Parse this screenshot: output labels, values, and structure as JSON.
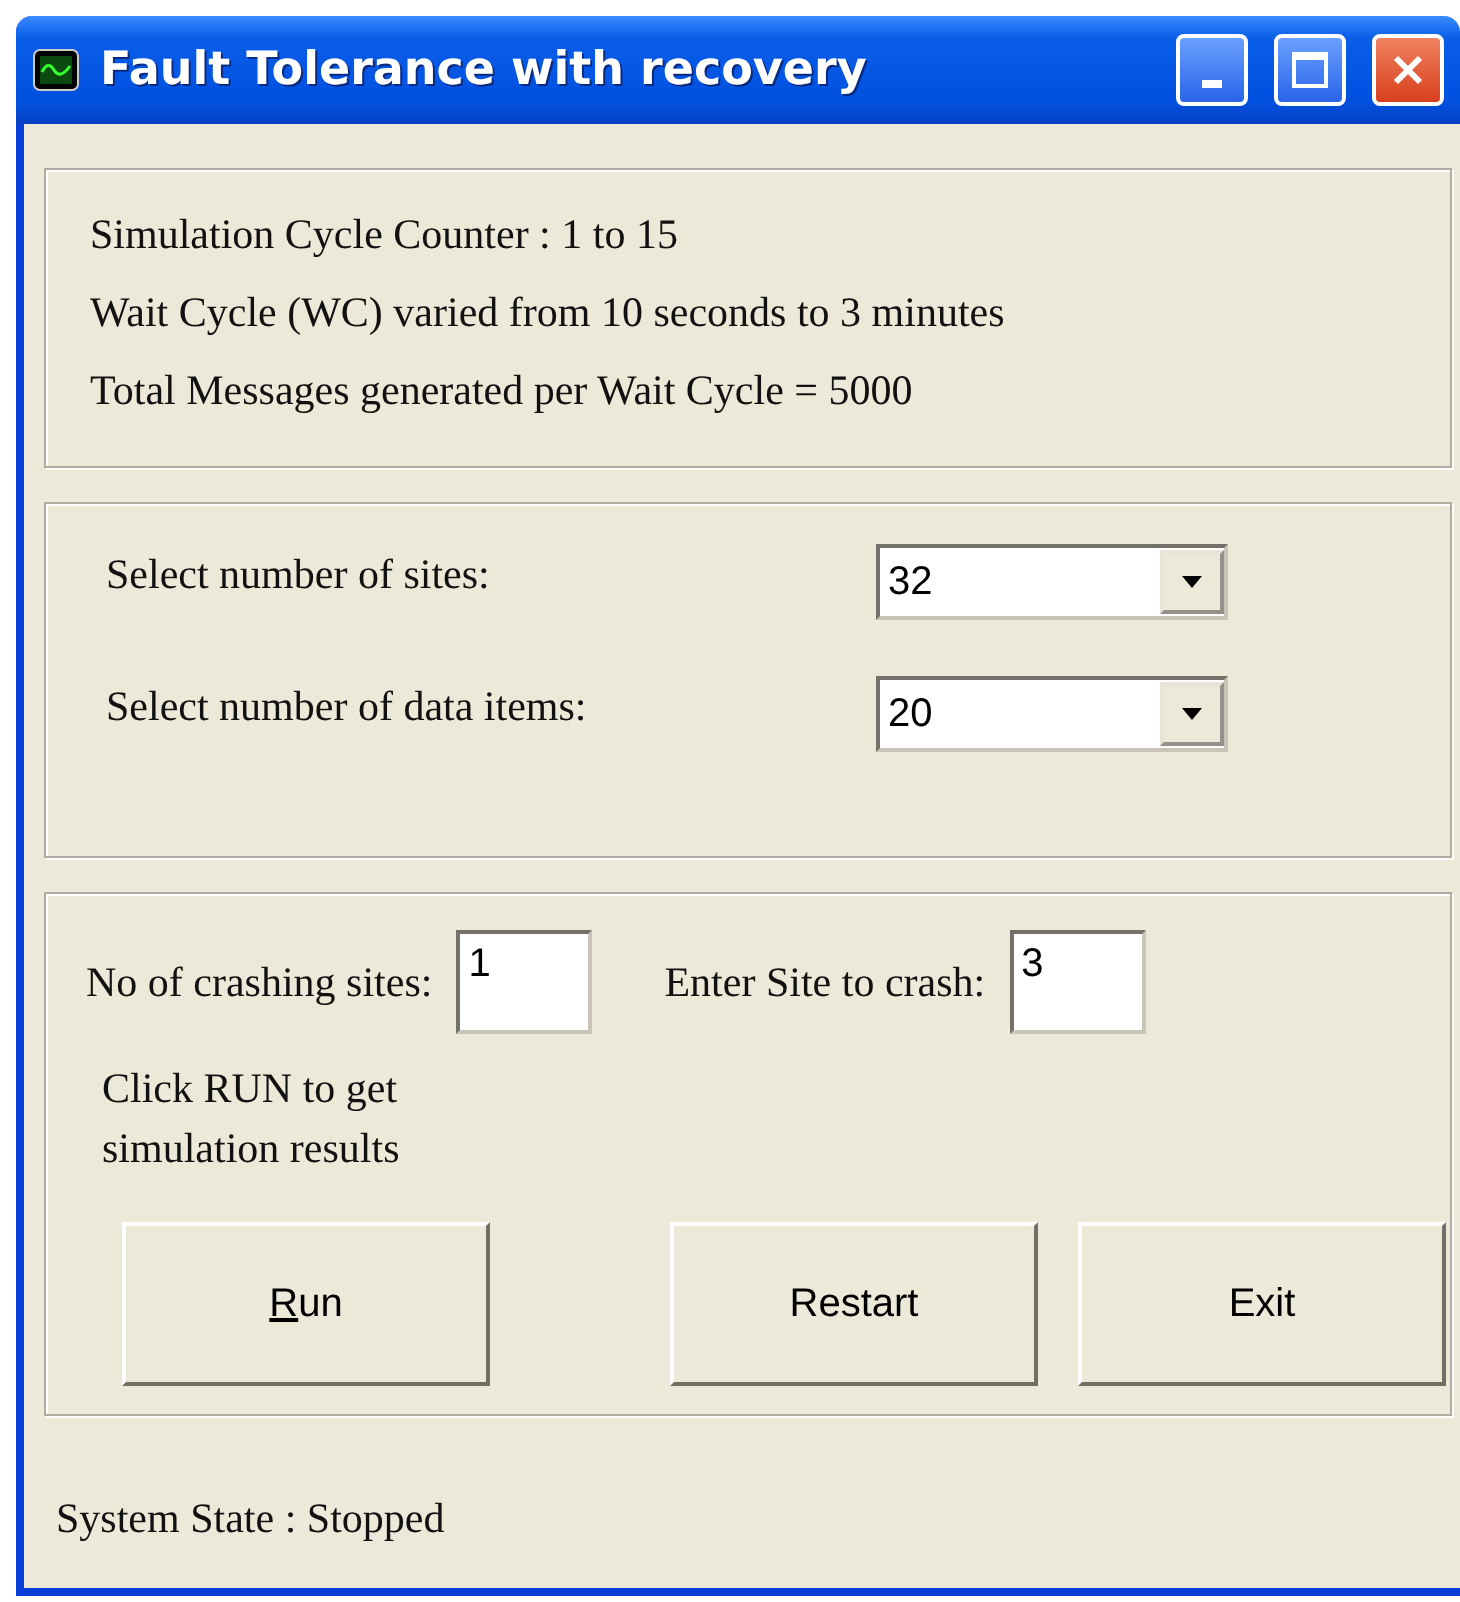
{
  "window": {
    "title": "Fault Tolerance with recovery"
  },
  "info_lines": [
    "Simulation Cycle Counter  : 1 to 15",
    "Wait Cycle (WC) varied from 10 seconds to 3 minutes",
    "Total Messages generated per Wait Cycle = 5000"
  ],
  "selects": [
    {
      "label": "Select number of sites:",
      "value": "32"
    },
    {
      "label": "Select number of data items:",
      "value": "20"
    }
  ],
  "crash_fields": [
    {
      "label": "No of crashing sites:",
      "value": "1"
    },
    {
      "label": "Enter Site to crash:",
      "value": "3"
    }
  ],
  "hint": "Click RUN to get simulation results",
  "buttons": [
    {
      "label": "Run",
      "first_letter_underlined": true
    },
    {
      "label": "Restart"
    },
    {
      "label": "Exit"
    }
  ],
  "status": "System State : Stopped"
}
